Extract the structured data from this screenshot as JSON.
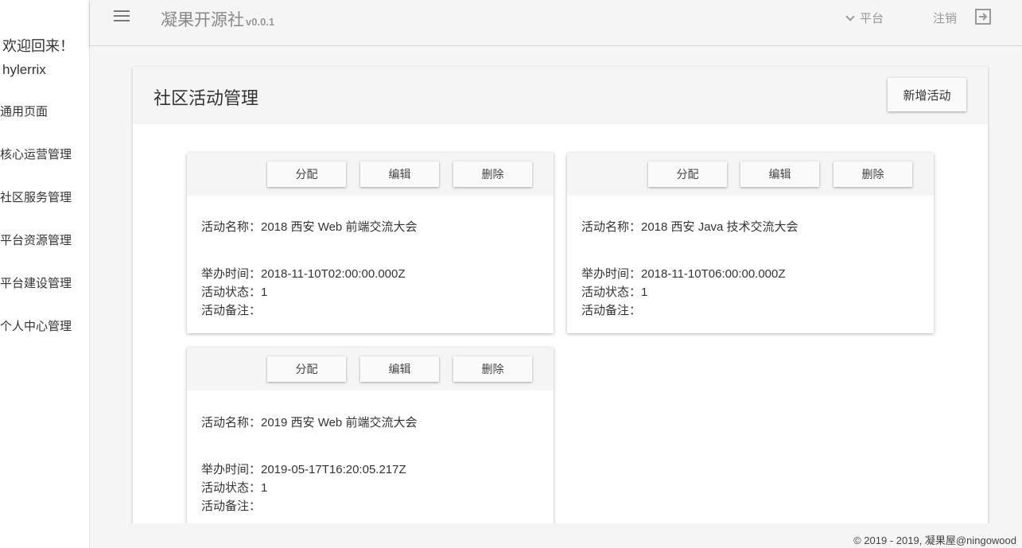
{
  "sidebar": {
    "welcome": "欢迎回来！",
    "username": "hylerrix",
    "items": [
      {
        "label": "通用页面"
      },
      {
        "label": "核心运营管理"
      },
      {
        "label": "社区服务管理"
      },
      {
        "label": "平台资源管理"
      },
      {
        "label": "平台建设管理"
      },
      {
        "label": "个人中心管理"
      }
    ]
  },
  "header": {
    "menu_icon": "menu-icon",
    "brand": "凝果开源社",
    "version": "v0.0.1",
    "platform_label": "平台",
    "logout_label": "注销",
    "logout_icon": "exit-icon"
  },
  "main": {
    "title": "社区活动管理",
    "add_button": "新增活动",
    "cards": [
      {
        "actions": [
          "分配",
          "编辑",
          "删除"
        ],
        "name": "活动名称：2018 西安 Web 前端交流大会",
        "time": "举办时间：2018-11-10T02:00:00.000Z",
        "status": "活动状态：1",
        "note": "活动备注："
      },
      {
        "actions": [
          "分配",
          "编辑",
          "删除"
        ],
        "name": "活动名称：2018 西安 Java 技术交流大会",
        "time": "举办时间：2018-11-10T06:00:00.000Z",
        "status": "活动状态：1",
        "note": "活动备注："
      },
      {
        "actions": [
          "分配",
          "编辑",
          "删除"
        ],
        "name": "活动名称：2019 西安 Web 前端交流大会",
        "time": "举办时间：2019-05-17T16:20:05.217Z",
        "status": "活动状态：1",
        "note": "活动备注："
      }
    ]
  },
  "footer": {
    "text": "© 2019 - 2019, 凝果屋@ningowood"
  }
}
